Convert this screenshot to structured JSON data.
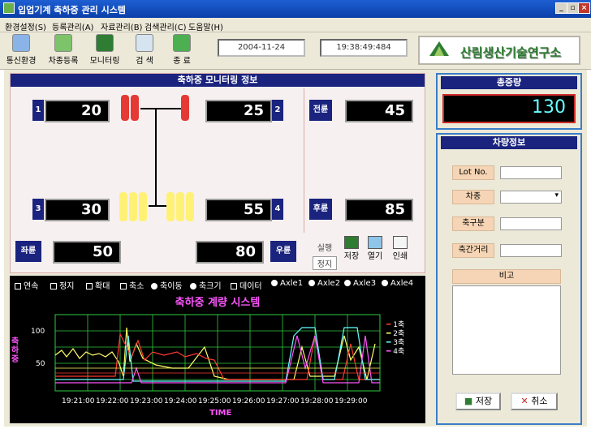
{
  "window": {
    "title": "입업기계 축하중 관리 시스템"
  },
  "menu": [
    "환경설정(S)",
    "등록관리(A)",
    "자료관리(B)",
    "검색관리(C)",
    "도움말(H)"
  ],
  "toolbar": {
    "buttons": [
      "통신환경",
      "차종등록",
      "모니터링",
      "검 색",
      "종 료"
    ],
    "date": "2004-11-24",
    "time": "19:38:49:484",
    "logo": "산림생산기술연구소"
  },
  "monitor": {
    "title": "축하중 모니터링 정보",
    "w1": "20",
    "w2": "25",
    "w3": "30",
    "w4": "55",
    "front_label": "전륜",
    "front": "45",
    "rear_label": "후륜",
    "rear": "85",
    "left_label": "좌륜",
    "left": "50",
    "right_label": "우륜",
    "right": "80",
    "n1": "1",
    "n2": "2",
    "n3": "3",
    "n4": "4",
    "ctl": [
      "실행",
      "정지",
      "저장",
      "열기",
      "인쇄"
    ]
  },
  "total": {
    "title": "총중량",
    "value": "130"
  },
  "vehicle": {
    "title": "차량정보",
    "lot_label": "Lot No.",
    "type_label": "차종",
    "axle_label": "축구분",
    "dist_label": "축간거리",
    "note_label": "비고",
    "save": "저장",
    "cancel": "취소"
  },
  "graph": {
    "controls": [
      "연속",
      "정지",
      "확대",
      "축소",
      "축이동",
      "축크기",
      "데이터",
      "Axle1",
      "Axle2",
      "Axle3",
      "Axle4"
    ],
    "title": "축하중 계량 시스템",
    "ylabel": "축하중",
    "xlabel": "TIME",
    "yticks": [
      "100",
      "50"
    ],
    "xticks": [
      "19:21:00",
      "19:22:00",
      "19:23:00",
      "19:24:00",
      "19:25:00",
      "19:26:00",
      "19:27:00",
      "19:28:00",
      "19:29:00"
    ],
    "legend": [
      "1축",
      "2축",
      "3축",
      "4축"
    ],
    "colors": [
      "#ff3b30",
      "#ffff66",
      "#66ffff",
      "#ff55ff"
    ]
  }
}
